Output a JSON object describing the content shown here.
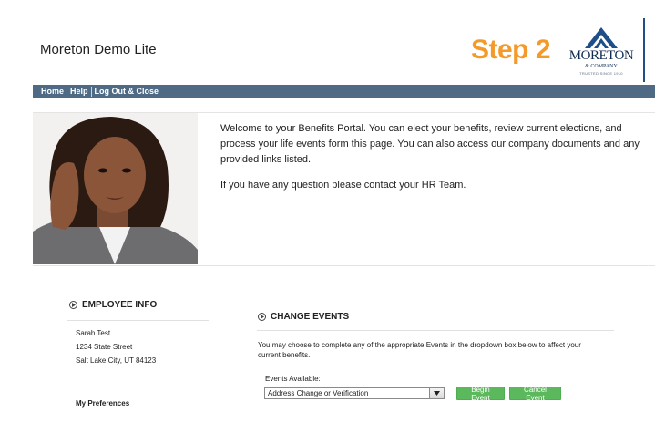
{
  "header": {
    "app_title": "Moreton Demo Lite",
    "step_label": "Step 2",
    "logo": {
      "name": "MORETON",
      "company": "& COMPANY",
      "tagline": "TRUSTED SINCE 1910"
    }
  },
  "nav": {
    "items": [
      {
        "label": "Home"
      },
      {
        "label": "Help"
      },
      {
        "label": "Log Out & Close"
      }
    ]
  },
  "welcome": {
    "message": "Welcome to your Benefits Portal. You can elect your benefits, review current elections, and process your life events form this page. You can also access our company documents and any provided links listed.",
    "contact": "If you have any question please contact your HR Team."
  },
  "employee_info": {
    "heading": "EMPLOYEE INFO",
    "name": "Sarah Test",
    "street": "1234 State Street",
    "city_line": "Salt Lake City, UT 84123",
    "preferences_heading": "My Preferences"
  },
  "change_events": {
    "heading": "CHANGE EVENTS",
    "description": "You may choose to complete any of the appropriate Events in the dropdown box below to affect your current benefits.",
    "events_label": "Events Available:",
    "selected_event": "Address Change or Verification",
    "begin_label": "Begin Event",
    "cancel_label": "Cancel Event"
  },
  "colors": {
    "accent_orange": "#f39a2a",
    "nav_bar": "#4e6a85",
    "button_green": "#5cb85c",
    "brand_navy": "#0f2b52"
  }
}
